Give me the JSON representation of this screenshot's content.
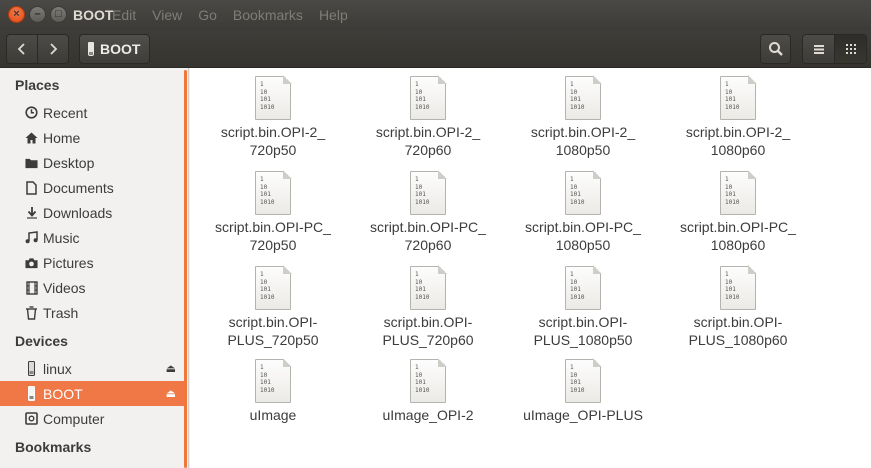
{
  "window": {
    "title": "BOOT"
  },
  "menu": [
    "Edit",
    "View",
    "Go",
    "Bookmarks",
    "Help"
  ],
  "toolbar": {
    "back_icon": "chevron-left-icon",
    "forward_icon": "chevron-right-icon",
    "path": "BOOT",
    "search_icon": "search-icon",
    "list_view_icon": "list-icon",
    "grid_view_icon": "grid-icon"
  },
  "sidebar": {
    "places_header": "Places",
    "places": [
      {
        "label": "Recent",
        "icon": "clock-icon"
      },
      {
        "label": "Home",
        "icon": "home-icon"
      },
      {
        "label": "Desktop",
        "icon": "desktop-folder-icon"
      },
      {
        "label": "Documents",
        "icon": "document-icon"
      },
      {
        "label": "Downloads",
        "icon": "download-icon"
      },
      {
        "label": "Music",
        "icon": "music-icon"
      },
      {
        "label": "Pictures",
        "icon": "camera-icon"
      },
      {
        "label": "Videos",
        "icon": "film-icon"
      },
      {
        "label": "Trash",
        "icon": "trash-icon"
      }
    ],
    "devices_header": "Devices",
    "devices": [
      {
        "label": "linux",
        "icon": "drive-icon",
        "eject": true
      },
      {
        "label": "BOOT",
        "icon": "drive-icon",
        "eject": true,
        "active": true
      },
      {
        "label": "Computer",
        "icon": "computer-icon",
        "eject": false
      }
    ],
    "bookmarks_header": "Bookmarks"
  },
  "files": [
    {
      "line1": "script.bin.OPI-2_",
      "line2": "720p50"
    },
    {
      "line1": "script.bin.OPI-2_",
      "line2": "720p60"
    },
    {
      "line1": "script.bin.OPI-2_",
      "line2": "1080p50"
    },
    {
      "line1": "script.bin.OPI-2_",
      "line2": "1080p60"
    },
    {
      "line1": "script.bin.OPI-PC_",
      "line2": "720p50"
    },
    {
      "line1": "script.bin.OPI-PC_",
      "line2": "720p60"
    },
    {
      "line1": "script.bin.OPI-PC_",
      "line2": "1080p50"
    },
    {
      "line1": "script.bin.OPI-PC_",
      "line2": "1080p60"
    },
    {
      "line1": "script.bin.OPI-",
      "line2": "PLUS_720p50"
    },
    {
      "line1": "script.bin.OPI-",
      "line2": "PLUS_720p60"
    },
    {
      "line1": "script.bin.OPI-",
      "line2": "PLUS_1080p50"
    },
    {
      "line1": "script.bin.OPI-",
      "line2": "PLUS_1080p60"
    },
    {
      "line1": "uImage",
      "line2": ""
    },
    {
      "line1": "uImage_OPI-2",
      "line2": ""
    },
    {
      "line1": "uImage_OPI-PLUS",
      "line2": ""
    }
  ],
  "file_icon": {
    "name": "binary-file-icon",
    "glyph_lines": [
      "1",
      "10",
      "101",
      "1010"
    ]
  },
  "colors": {
    "accent": "#f07746",
    "titlebar": "#3c3b37"
  }
}
